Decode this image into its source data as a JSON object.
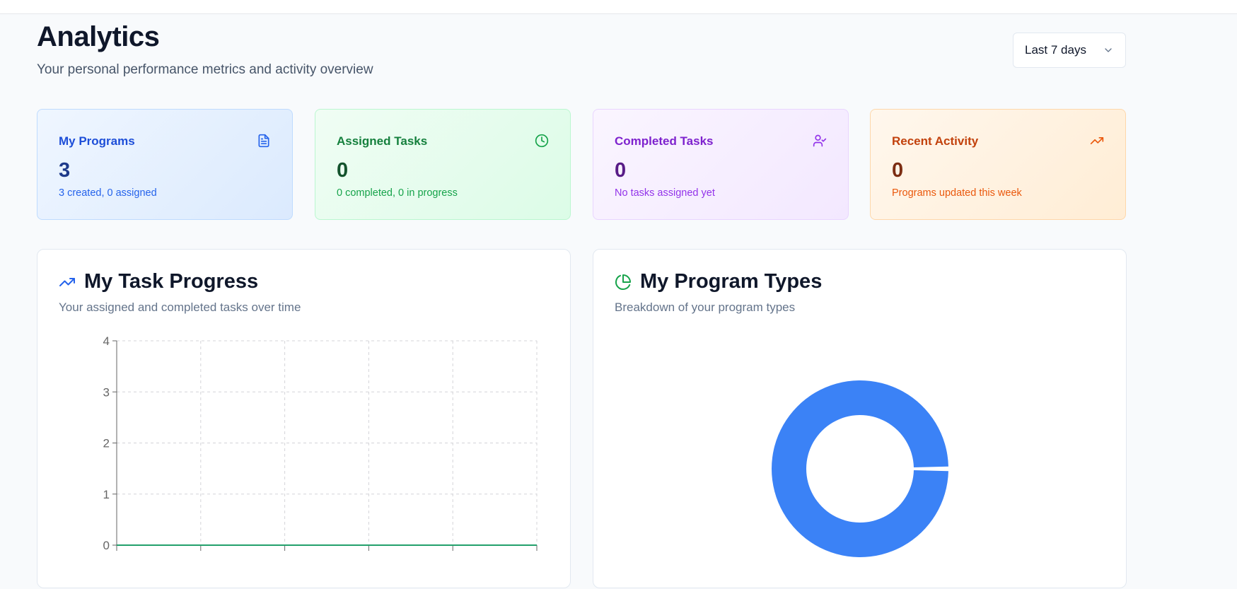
{
  "header": {
    "title": "Analytics",
    "subtitle": "Your personal performance metrics and activity overview",
    "range_select": {
      "value": "Last 7 days"
    }
  },
  "stats": [
    {
      "label": "My Programs",
      "value": "3",
      "sub": "3 created, 0 assigned",
      "icon": "document-icon"
    },
    {
      "label": "Assigned Tasks",
      "value": "0",
      "sub": "0 completed, 0 in progress",
      "icon": "clock-icon"
    },
    {
      "label": "Completed Tasks",
      "value": "0",
      "sub": "No tasks assigned yet",
      "icon": "user-check-icon"
    },
    {
      "label": "Recent Activity",
      "value": "0",
      "sub": "Programs updated this week",
      "icon": "trending-up-icon"
    }
  ],
  "task_progress": {
    "title": "My Task Progress",
    "subtitle": "Your assigned and completed tasks over time",
    "icon": "trending-up-icon"
  },
  "program_types": {
    "title": "My Program Types",
    "subtitle": "Breakdown of your program types",
    "icon": "pie-chart-icon"
  },
  "colors": {
    "line_series": "#22a06b",
    "donut": "#3b82f6",
    "icon_blue": "#2563eb",
    "icon_green": "#16a34a"
  },
  "chart_data": [
    {
      "type": "line",
      "y_ticks": [
        "0",
        "1",
        "2",
        "3",
        "4"
      ],
      "ylim": [
        0,
        4
      ],
      "grid": true,
      "series": [
        {
          "values": [
            0,
            0,
            0,
            0,
            0,
            0
          ]
        }
      ]
    },
    {
      "type": "pie",
      "donut": true,
      "slices": [
        {
          "value": 3
        }
      ]
    }
  ]
}
